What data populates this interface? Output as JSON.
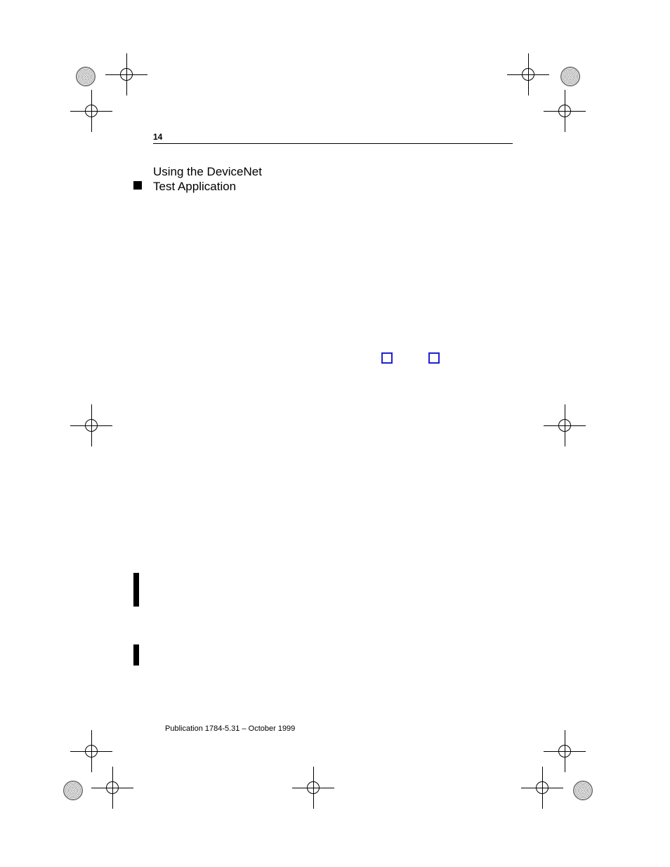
{
  "page_number": "14",
  "heading_line1": "Using the DeviceNet",
  "heading_line2": "Test Application",
  "footer": "Publication 1784-5.31 – October 1999"
}
